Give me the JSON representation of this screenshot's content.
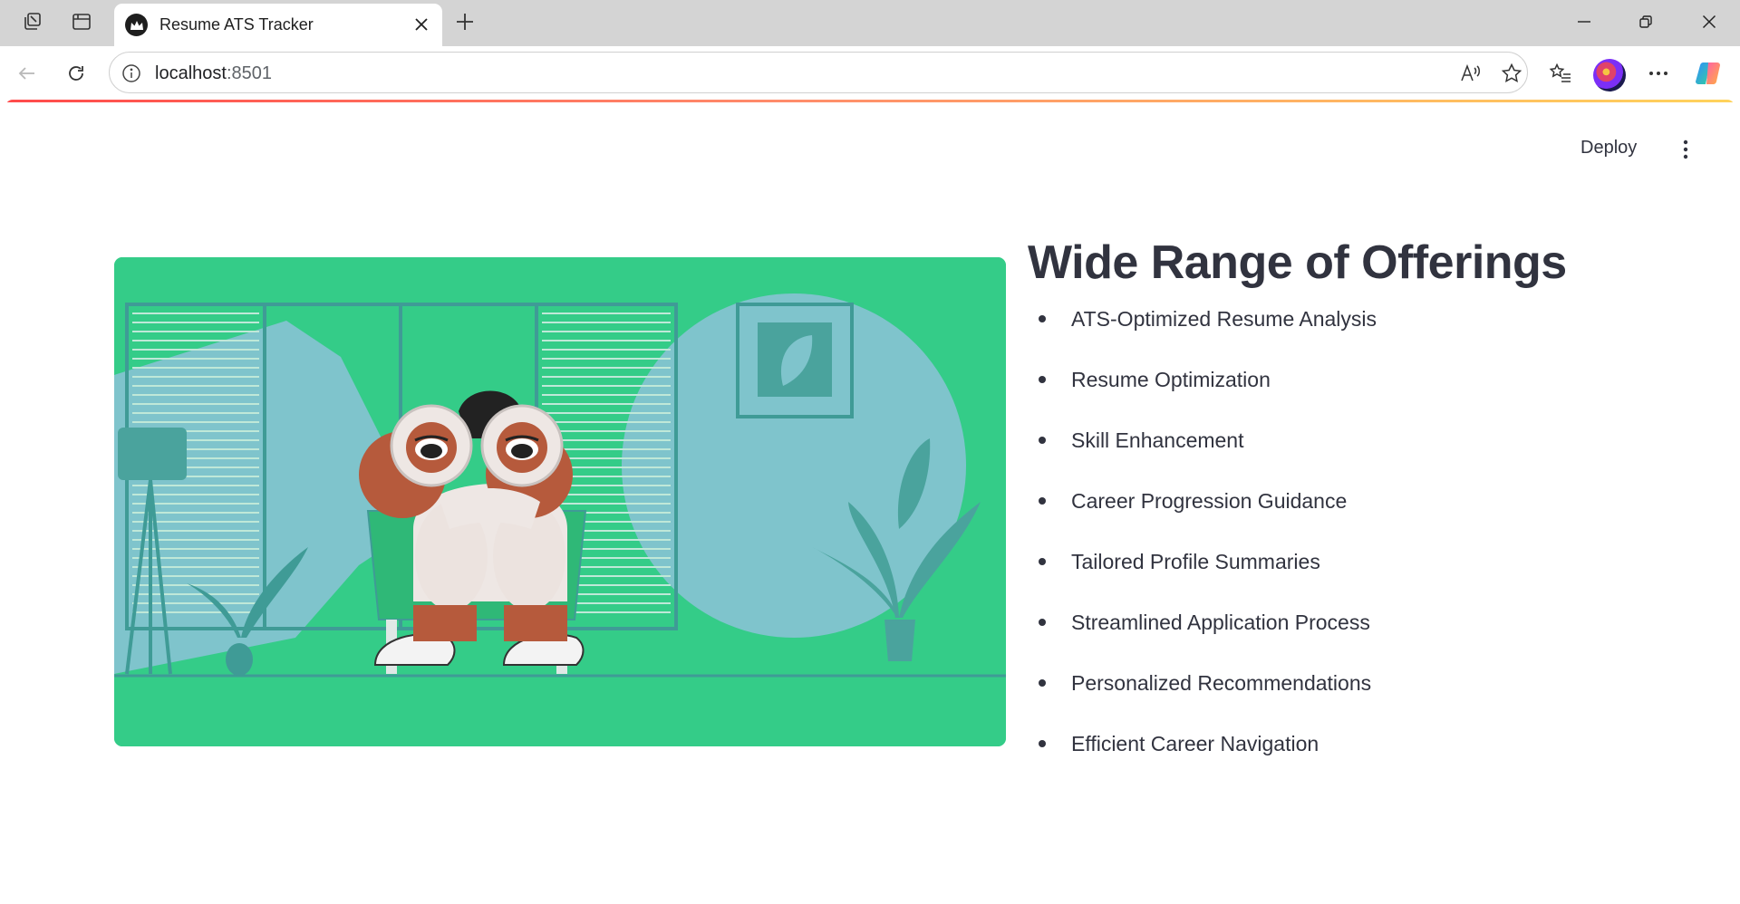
{
  "browser": {
    "tab": {
      "title": "Resume ATS Tracker",
      "favicon": "streamlit-crown-icon"
    },
    "address": {
      "host": "localhost",
      "port": ":8501"
    },
    "icons": {
      "workspaces": "workspaces-icon",
      "tab_actions": "tab-actions-icon",
      "close_tab": "close-icon",
      "new_tab": "plus-icon",
      "minimize": "minimize-icon",
      "restore": "restore-icon",
      "close_window": "close-icon",
      "back": "back-arrow-icon",
      "refresh": "refresh-icon",
      "site_info": "info-icon",
      "read_aloud": "read-aloud-icon",
      "favorite": "star-icon",
      "favorites_bar": "favorites-list-icon",
      "settings_more": "more-horizontal-icon",
      "copilot": "copilot-icon"
    }
  },
  "app": {
    "deploy_label": "Deploy",
    "menu_icon": "more-vertical-icon",
    "image_alt": "illustration-person-with-binoculars",
    "heading": "Wide Range of Offerings",
    "offerings": [
      "ATS-Optimized Resume Analysis",
      "Resume Optimization",
      "Skill Enhancement",
      "Career Progression Guidance",
      "Tailored Profile Summaries",
      "Streamlined Application Process",
      "Personalized Recommendations",
      "Efficient Career Navigation"
    ]
  },
  "colors": {
    "image_bg": "#34cc88",
    "image_accent": "#7fc4cc",
    "text": "#31333f",
    "progress_start": "#ff4b4b",
    "progress_end": "#ffd35c"
  }
}
